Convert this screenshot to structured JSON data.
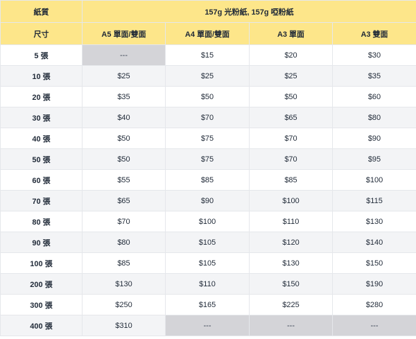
{
  "header": {
    "paper_label": "紙質",
    "paper_value": "157g 光粉紙, 157g 啞粉紙",
    "size_label": "尺寸",
    "columns": [
      "A5 單面/雙面",
      "A4 單面/雙面",
      "A3 單面",
      "A3 雙面"
    ]
  },
  "rows": [
    {
      "qty": "5 張",
      "prices": [
        "---",
        "$15",
        "$20",
        "$30"
      ],
      "na": [
        true,
        false,
        false,
        false
      ]
    },
    {
      "qty": "10 張",
      "prices": [
        "$25",
        "$25",
        "$25",
        "$35"
      ],
      "na": [
        false,
        false,
        false,
        false
      ]
    },
    {
      "qty": "20 張",
      "prices": [
        "$35",
        "$50",
        "$50",
        "$60"
      ],
      "na": [
        false,
        false,
        false,
        false
      ]
    },
    {
      "qty": "30 張",
      "prices": [
        "$40",
        "$70",
        "$65",
        "$80"
      ],
      "na": [
        false,
        false,
        false,
        false
      ]
    },
    {
      "qty": "40 張",
      "prices": [
        "$50",
        "$75",
        "$70",
        "$90"
      ],
      "na": [
        false,
        false,
        false,
        false
      ]
    },
    {
      "qty": "50 張",
      "prices": [
        "$50",
        "$75",
        "$70",
        "$95"
      ],
      "na": [
        false,
        false,
        false,
        false
      ]
    },
    {
      "qty": "60 張",
      "prices": [
        "$55",
        "$85",
        "$85",
        "$100"
      ],
      "na": [
        false,
        false,
        false,
        false
      ]
    },
    {
      "qty": "70 張",
      "prices": [
        "$65",
        "$90",
        "$100",
        "$115"
      ],
      "na": [
        false,
        false,
        false,
        false
      ]
    },
    {
      "qty": "80 張",
      "prices": [
        "$70",
        "$100",
        "$110",
        "$130"
      ],
      "na": [
        false,
        false,
        false,
        false
      ]
    },
    {
      "qty": "90 張",
      "prices": [
        "$80",
        "$105",
        "$120",
        "$140"
      ],
      "na": [
        false,
        false,
        false,
        false
      ]
    },
    {
      "qty": "100 張",
      "prices": [
        "$85",
        "$105",
        "$130",
        "$150"
      ],
      "na": [
        false,
        false,
        false,
        false
      ]
    },
    {
      "qty": "200 張",
      "prices": [
        "$130",
        "$110",
        "$150",
        "$190"
      ],
      "na": [
        false,
        false,
        false,
        false
      ]
    },
    {
      "qty": "300 張",
      "prices": [
        "$250",
        "$165",
        "$225",
        "$280"
      ],
      "na": [
        false,
        false,
        false,
        false
      ]
    },
    {
      "qty": "400 張",
      "prices": [
        "$310",
        "---",
        "---",
        "---"
      ],
      "na": [
        false,
        true,
        true,
        true
      ]
    }
  ],
  "colors": {
    "header_bg": "#fde68a",
    "stripe_bg": "#f3f4f6",
    "na_bg": "#d4d4d8"
  }
}
